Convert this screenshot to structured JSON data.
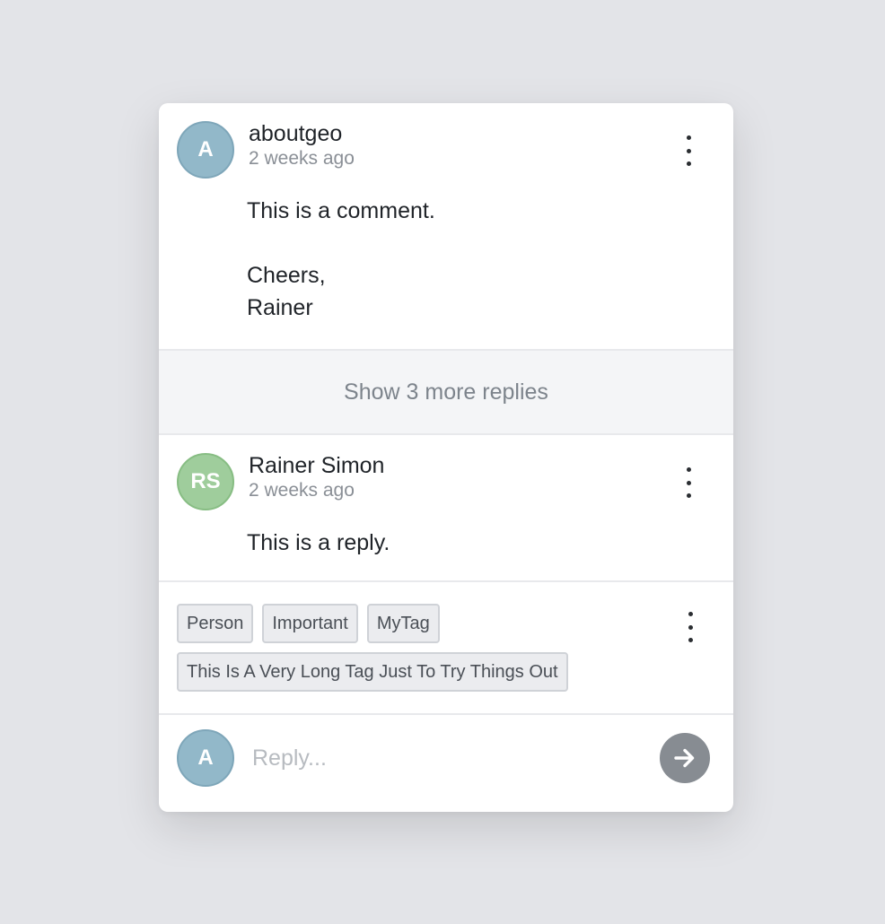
{
  "thread": {
    "comment": {
      "avatar_initials": "A",
      "author": "aboutgeo",
      "time": "2 weeks ago",
      "body": "This is a comment.\n\nCheers,\nRainer"
    },
    "show_more_label": "Show 3 more replies",
    "reply": {
      "avatar_initials": "RS",
      "author": "Rainer Simon",
      "time": "2 weeks ago",
      "body": "This is a reply."
    },
    "tags": [
      "Person",
      "Important",
      "MyTag",
      "This Is A Very Long Tag Just To Try Things Out"
    ],
    "composer": {
      "avatar_initials": "A",
      "placeholder": "Reply..."
    }
  },
  "colors": {
    "avatar_blue": "#92b8c9",
    "avatar_green": "#9fcd9c",
    "send_button": "#878c92"
  },
  "icons": {
    "menu": "vertical-ellipsis-icon",
    "send": "arrow-right-icon"
  }
}
